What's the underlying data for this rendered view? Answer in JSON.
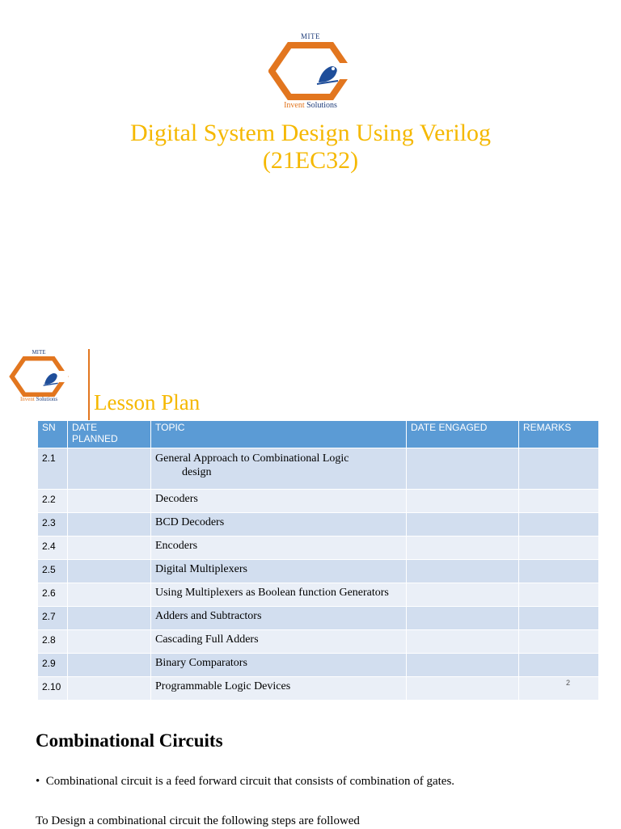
{
  "slide1": {
    "logo": {
      "top_text": "MITE",
      "bottom_accent": "Invent",
      "bottom_text": " Solutions"
    },
    "title_line1": "Digital System Design Using Verilog",
    "title_line2": "(21EC32)"
  },
  "slide2": {
    "logo": {
      "top_text": "MITE",
      "bottom_accent": "Invent",
      "bottom_text": " Solutions"
    },
    "title": "Lesson Plan",
    "table": {
      "headers": {
        "sn": "SN",
        "date_planned_1": "DATE",
        "date_planned_2": "PLANNED",
        "topic": "TOPIC",
        "date_engaged": "DATE ENGAGED",
        "remarks": "REMARKS"
      },
      "rows": [
        {
          "sn": "2.1",
          "topic_line1": "General Approach to Combinational Logic",
          "topic_line2": "design",
          "date_planned": "",
          "date_engaged": "",
          "remarks": ""
        },
        {
          "sn": "2.2",
          "topic": "Decoders",
          "date_planned": "",
          "date_engaged": "",
          "remarks": ""
        },
        {
          "sn": "2.3",
          "topic": "BCD Decoders",
          "date_planned": "",
          "date_engaged": "",
          "remarks": ""
        },
        {
          "sn": "2.4",
          "topic": "Encoders",
          "date_planned": "",
          "date_engaged": "",
          "remarks": ""
        },
        {
          "sn": "2.5",
          "topic": "Digital Multiplexers",
          "date_planned": "",
          "date_engaged": "",
          "remarks": ""
        },
        {
          "sn": "2.6",
          "topic": "Using Multiplexers as Boolean function Generators",
          "date_planned": "",
          "date_engaged": "",
          "remarks": ""
        },
        {
          "sn": "2.7",
          "topic": "Adders and Subtractors",
          "date_planned": "",
          "date_engaged": "",
          "remarks": ""
        },
        {
          "sn": "2.8",
          "topic": "Cascading Full Adders",
          "date_planned": "",
          "date_engaged": "",
          "remarks": ""
        },
        {
          "sn": "2.9",
          "topic": "Binary Comparators",
          "date_planned": "",
          "date_engaged": "",
          "remarks": ""
        },
        {
          "sn": "2.10",
          "topic": "Programmable Logic Devices",
          "date_planned": "",
          "date_engaged": "",
          "remarks": ""
        }
      ]
    },
    "page_number": "2"
  },
  "slide3": {
    "heading": "Combinational Circuits",
    "bullet_symbol": "•",
    "bullet": "Combinational circuit is a feed forward circuit that consists of combination of gates.",
    "paragraph": "To Design a combinational circuit the following steps are followed"
  },
  "colors": {
    "title_gold": "#f5b800",
    "accent_orange": "#e2761f",
    "header_blue": "#5b9bd5",
    "row_dark": "#d2deef",
    "row_light": "#eaeff7",
    "logo_blue": "#1f3d7a"
  }
}
